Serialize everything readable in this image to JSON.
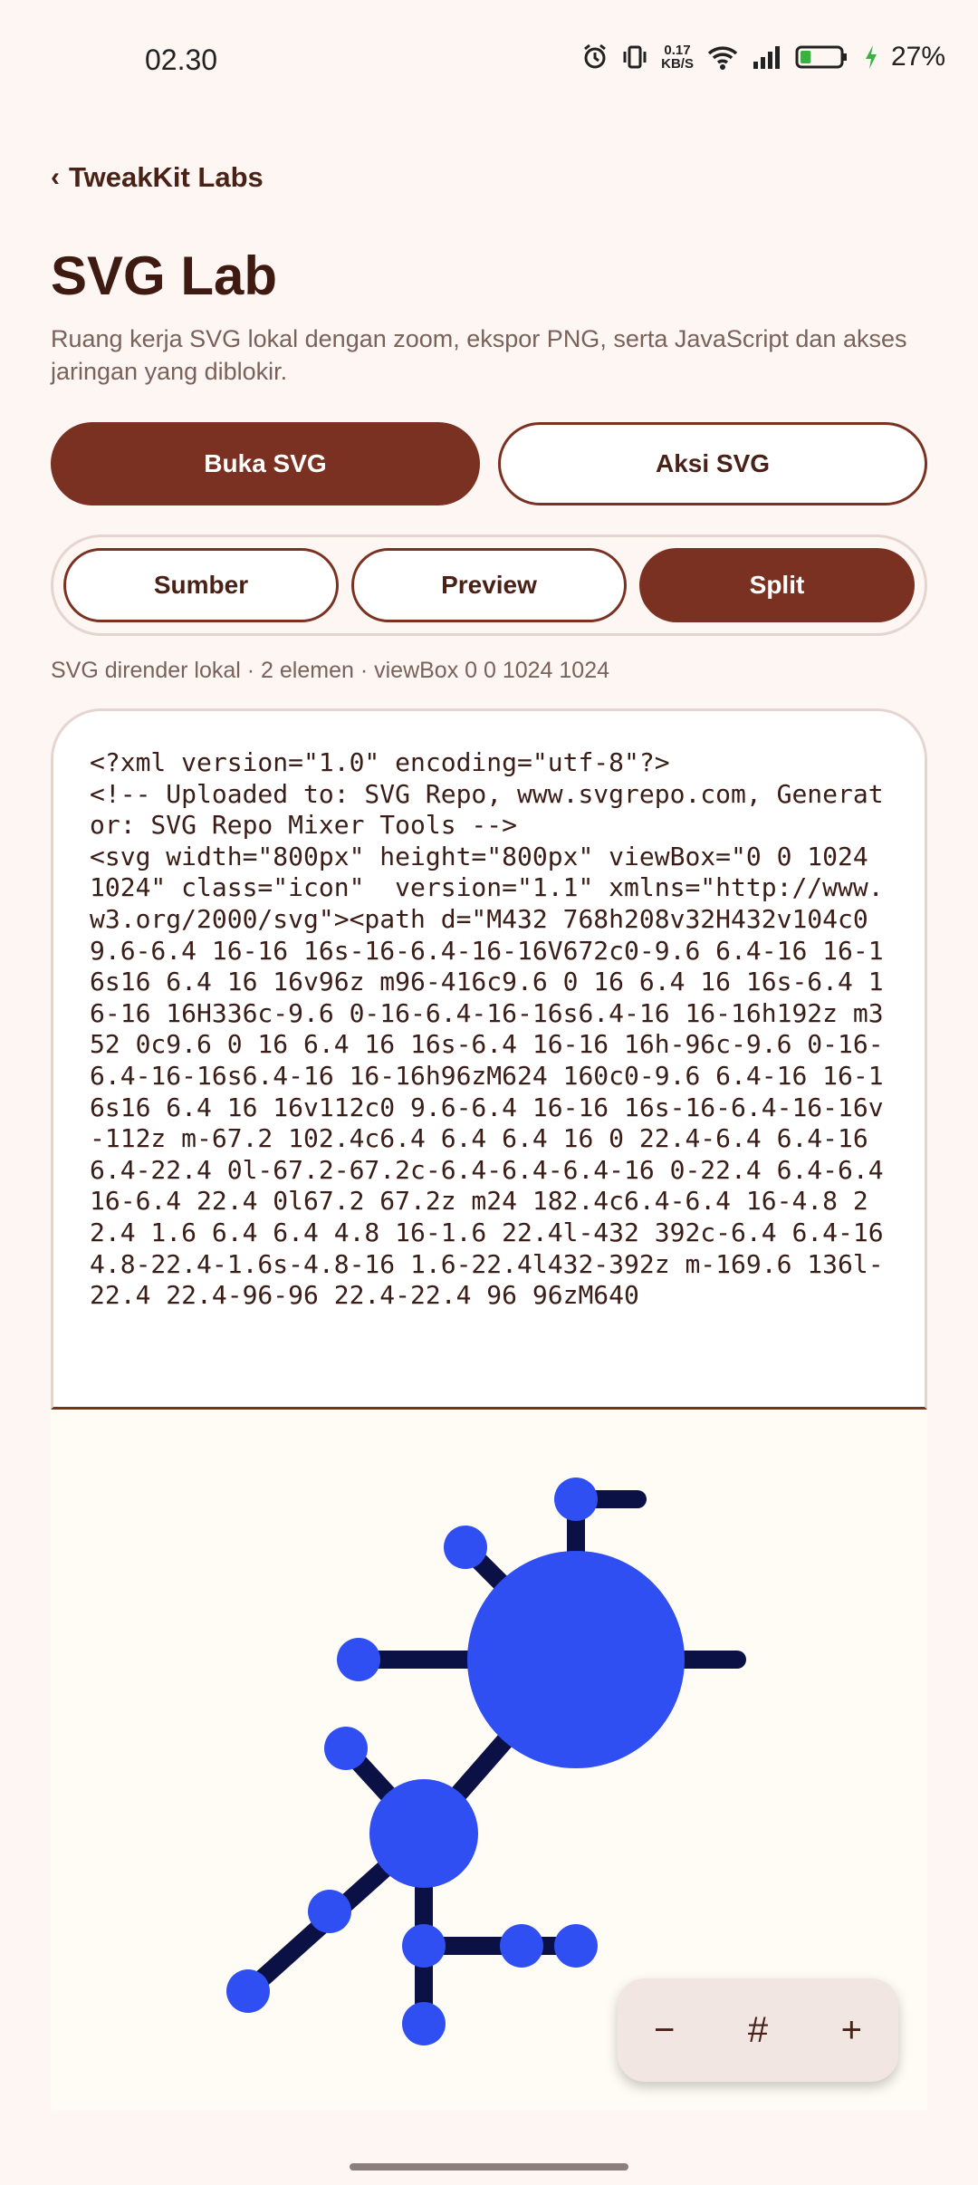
{
  "status": {
    "time": "02.30",
    "net_speed_value": "0.17",
    "net_speed_unit": "KB/S",
    "battery_percent": "27%",
    "battery_level": 0.27
  },
  "header": {
    "back_label": "TweakKit Labs",
    "title": "SVG Lab",
    "subtitle": "Ruang kerja SVG lokal dengan zoom, ekspor PNG, serta JavaScript dan akses jaringan yang diblokir."
  },
  "actions": {
    "open_label": "Buka SVG",
    "svg_actions_label": "Aksi SVG"
  },
  "view_modes": {
    "items": [
      "Sumber",
      "Preview",
      "Split"
    ],
    "selected": "Split"
  },
  "meta_text": "SVG dirender lokal · 2 elemen · viewBox 0 0 1024 1024",
  "source_code": "<?xml version=\"1.0\" encoding=\"utf-8\"?>\n<!-- Uploaded to: SVG Repo, www.svgrepo.com, Generator: SVG Repo Mixer Tools -->\n<svg width=\"800px\" height=\"800px\" viewBox=\"0 0 1024 1024\" class=\"icon\"  version=\"1.1\" xmlns=\"http://www.w3.org/2000/svg\"><path d=\"M432 768h208v32H432v104c0 9.6-6.4 16-16 16s-16-6.4-16-16V672c0-9.6 6.4-16 16-16s16 6.4 16 16v96z m96-416c9.6 0 16 6.4 16 16s-6.4 16-16 16H336c-9.6 0-16-6.4-16-16s6.4-16 16-16h192z m352 0c9.6 0 16 6.4 16 16s-6.4 16-16 16h-96c-9.6 0-16-6.4-16-16s6.4-16 16-16h96zM624 160c0-9.6 6.4-16 16-16s16 6.4 16 16v112c0 9.6-6.4 16-16 16s-16-6.4-16-16v-112z m-67.2 102.4c6.4 6.4 6.4 16 0 22.4-6.4 6.4-16 6.4-22.4 0l-67.2-67.2c-6.4-6.4-6.4-16 0-22.4 6.4-6.4 16-6.4 22.4 0l67.2 67.2z m24 182.4c6.4-6.4 16-4.8 22.4 1.6 6.4 6.4 4.8 16-1.6 22.4l-432 392c-6.4 6.4-16 4.8-22.4-1.6s-4.8-16 1.6-22.4l432-392z m-169.6 136l-22.4 22.4-96-96 22.4-22.4 96 96zM640",
  "preview_colors": {
    "line": "#0c1145",
    "node": "#2f4ff2"
  },
  "zoom_controls": {
    "minus": "−",
    "grid": "#",
    "plus": "+"
  }
}
